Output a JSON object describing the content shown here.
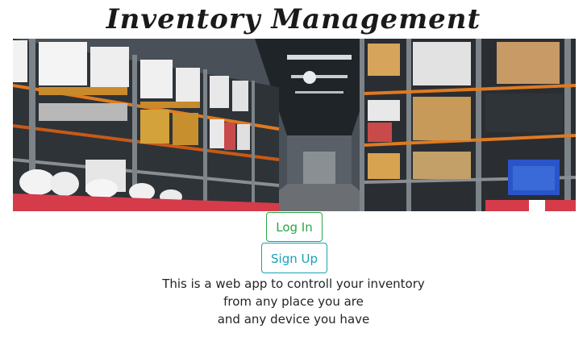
{
  "header": {
    "title": "Inventory Management"
  },
  "hero": {
    "image_subject": "warehouse-shelves"
  },
  "actions": {
    "login_label": "Log In",
    "signup_label": "Sign Up"
  },
  "description": {
    "line1": "This is a web app to controll your inventory",
    "line2": "from any place you are",
    "line3": "and any device you have"
  },
  "colors": {
    "login_accent": "#28a745",
    "signup_accent": "#17a2b8"
  }
}
